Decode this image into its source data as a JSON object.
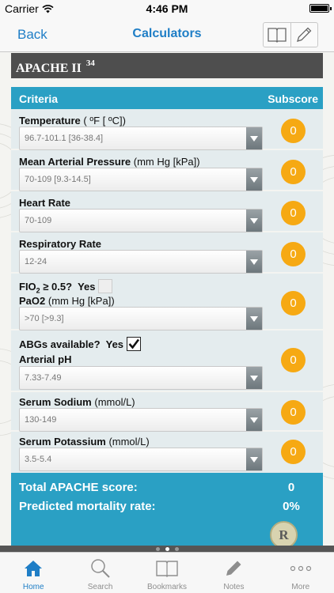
{
  "status_bar": {
    "carrier": "Carrier",
    "time": "4:46 PM"
  },
  "nav": {
    "back_label": "Back",
    "title": "Calculators",
    "icons": [
      "book-icon",
      "pencil-icon"
    ]
  },
  "calculator": {
    "title": "APACHE II",
    "ref": "34"
  },
  "table": {
    "header_criteria": "Criteria",
    "header_subscore": "Subscore"
  },
  "rows": [
    {
      "label_bold": "Temperature",
      "label_unit": " ( ºF [ ºC])",
      "value": "96.7-101.1 [36-38.4]",
      "subscore": "0"
    },
    {
      "label_bold": "Mean Arterial Pressure",
      "label_unit": " (mm Hg [kPa])",
      "value": "70-109 [9.3-14.5]",
      "subscore": "0"
    },
    {
      "label_bold": "Heart Rate",
      "label_unit": "",
      "value": "70-109",
      "subscore": "0"
    },
    {
      "label_bold": "Respiratory Rate",
      "label_unit": "",
      "value": "12-24",
      "subscore": "0"
    },
    {
      "fio2_question": "FIO",
      "fio2_sub": "2",
      "fio2_rest": " ≥ 0.5?",
      "fio2_answer": "Yes",
      "fio2_checked": false,
      "label_bold": "PaO2",
      "label_unit": " (mm Hg [kPa])",
      "value": ">70 [>9.3]",
      "subscore": "0"
    },
    {
      "abg_question": "ABGs available?",
      "abg_answer": "Yes",
      "abg_checked": true,
      "label_bold": "Arterial pH",
      "label_unit": "",
      "value": "7.33-7.49",
      "subscore": "0"
    },
    {
      "label_bold": "Serum Sodium",
      "label_unit": " (mmol/L)",
      "value": "130-149",
      "subscore": "0"
    },
    {
      "label_bold": "Serum Potassium",
      "label_unit": " (mmol/L)",
      "value": "3.5-5.4",
      "subscore": "0"
    }
  ],
  "totals": {
    "score_label": "Total APACHE score:",
    "score_value": "0",
    "mortality_label": "Predicted mortality rate:",
    "mortality_value": "0%"
  },
  "floating_badge": "R",
  "tabs": [
    {
      "label": "Home",
      "icon": "home-icon",
      "active": true
    },
    {
      "label": "Search",
      "icon": "search-icon",
      "active": false
    },
    {
      "label": "Bookmarks",
      "icon": "book-icon",
      "active": false
    },
    {
      "label": "Notes",
      "icon": "pencil-icon",
      "active": false
    },
    {
      "label": "More",
      "icon": "more-icon",
      "active": false
    }
  ],
  "colors": {
    "accent": "#1f7ec6",
    "table_header": "#2aa0c4",
    "badge": "#f6a913",
    "title_bar": "#4e4e4e"
  }
}
